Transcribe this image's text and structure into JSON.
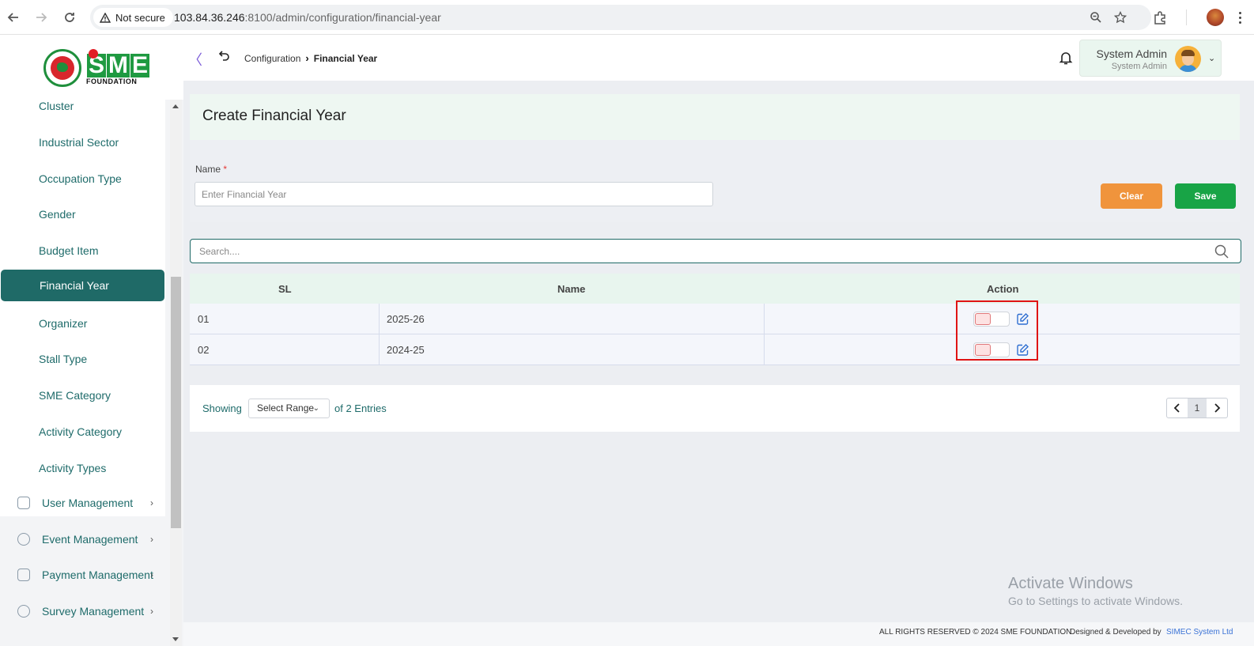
{
  "browser": {
    "security_label": "Not secure",
    "url_host": "103.84.36.246",
    "url_rest": ":8100/admin/configuration/financial-year"
  },
  "logo": {
    "sme_letters": [
      "S",
      "M",
      "E"
    ],
    "foundation_text": "FOUNDATION"
  },
  "sidebar": {
    "submenu": [
      {
        "label": "Cluster"
      },
      {
        "label": "Industrial Sector"
      },
      {
        "label": "Occupation Type"
      },
      {
        "label": "Gender"
      },
      {
        "label": "Budget Item"
      },
      {
        "label": "Financial Year",
        "active": true
      },
      {
        "label": "Organizer"
      },
      {
        "label": "Stall Type"
      },
      {
        "label": "SME Category"
      },
      {
        "label": "Activity Category"
      },
      {
        "label": "Activity Types"
      }
    ],
    "menu": [
      {
        "label": "User Management",
        "icon": "shield-user-icon"
      },
      {
        "label": "Event Management",
        "icon": "lock-circle-icon"
      },
      {
        "label": "Payment Management",
        "icon": "cash-icon"
      },
      {
        "label": "Survey Management",
        "icon": "pie-chart-icon"
      }
    ]
  },
  "header": {
    "breadcrumb_parent": "Configuration",
    "breadcrumb_current": "Financial Year",
    "user_name": "System Admin",
    "user_role": "System Admin"
  },
  "form": {
    "title": "Create Financial Year",
    "name_label": "Name",
    "required_mark": "*",
    "name_placeholder": "Enter Financial Year",
    "name_value": "",
    "clear_label": "Clear",
    "save_label": "Save"
  },
  "search": {
    "placeholder": "Search...."
  },
  "table": {
    "columns": [
      "SL",
      "Name",
      "Action"
    ],
    "rows": [
      {
        "sl": "01",
        "name": "2025-26",
        "active": false
      },
      {
        "sl": "02",
        "name": "2024-25",
        "active": false
      }
    ]
  },
  "pagination": {
    "showing": "Showing",
    "range_placeholder": "Select Range",
    "entries_text": "of 2 Entries",
    "current_page": "1"
  },
  "watermark": {
    "line1": "Activate Windows",
    "line2": "Go to Settings to activate Windows."
  },
  "footer": {
    "copyright": "ALL RIGHTS RESERVED © 2024 SME FOUNDATION",
    "developed_by": "Designed & Developed by",
    "developer": "SIMEC System Ltd"
  },
  "colors": {
    "brand_teal": "#1f6a67",
    "save_green": "#18a446",
    "clear_orange": "#f0943c",
    "highlight_red": "#e01414"
  }
}
